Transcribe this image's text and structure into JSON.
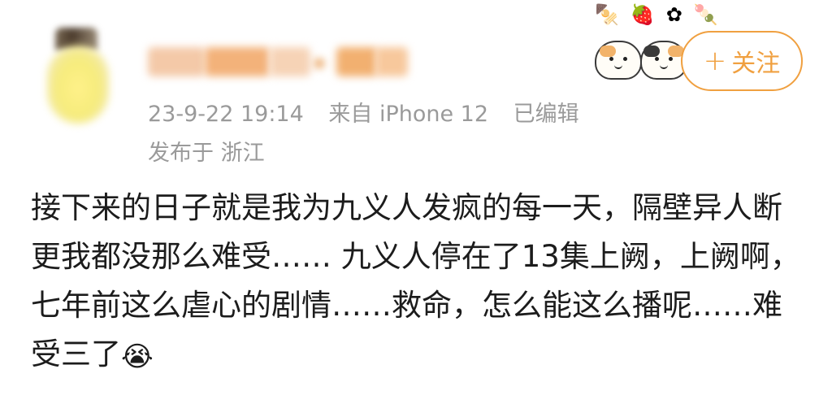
{
  "post": {
    "timestamp": "23-9-22 19:14",
    "source": "来自 iPhone 12",
    "edited": "已编辑",
    "location": "发布于 浙江",
    "body_text": "接下来的日子就是我为九义人发疯的每一天，隔壁异人断更我都没那么难受…… 九义人停在了13集上阙，上阙啊，七年前这么虐心的剧情……救命，怎么能这么播呢……难受三了",
    "body_emoji": "😭"
  },
  "header": {
    "follow_plus": "+",
    "follow_label": "关注"
  },
  "stickers": {
    "top_row": "🍢🍓✿🍡"
  },
  "colors": {
    "accent": "#f0a040",
    "meta_text": "#9a9a9a",
    "body_text": "#1c1c1c"
  }
}
